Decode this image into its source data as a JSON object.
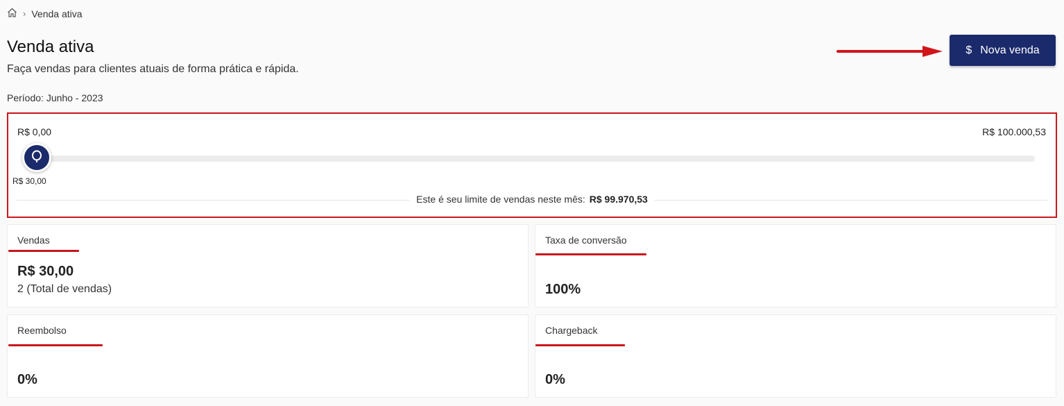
{
  "breadcrumb": {
    "current": "Venda ativa"
  },
  "header": {
    "title": "Venda ativa",
    "subtitle": "Faça vendas para clientes atuais de forma prática e rápida.",
    "period": "Período: Junho - 2023"
  },
  "new_sale_button": {
    "icon": "$",
    "label": "Nova venda",
    "color": "#1b2a6b"
  },
  "limit": {
    "min_label": "R$ 0,00",
    "max_label": "R$ 100.000,53",
    "current_label": "R$ 30,00",
    "progress_fraction": 0.0003,
    "text": "Este é seu limite de vendas neste mês:",
    "remaining": "R$ 99.970,53"
  },
  "stats": {
    "sales": {
      "label": "Vendas",
      "value": "R$ 30,00",
      "sub": "2 (Total de vendas)"
    },
    "conversion": {
      "label": "Taxa de conversão",
      "value": "100%"
    },
    "refund": {
      "label": "Reembolso",
      "value": "0%"
    },
    "chargeback": {
      "label": "Chargeback",
      "value": "0%"
    }
  },
  "accent_color": "#c8161d"
}
